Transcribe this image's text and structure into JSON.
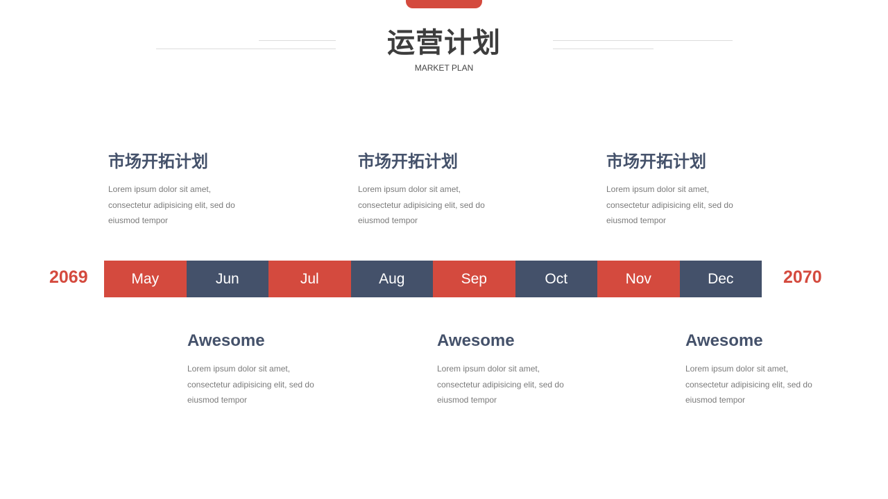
{
  "header": {
    "title": "运营计划",
    "subtitle": "MARKET PLAN"
  },
  "colors": {
    "accent": "#d44a3e",
    "dark": "#44516a"
  },
  "top_blocks": [
    {
      "heading": "市场开拓计划",
      "body": [
        "Lorem ipsum dolor sit amet,",
        "consectetur adipisicing elit, sed do",
        "eiusmod tempor"
      ]
    },
    {
      "heading": "市场开拓计划",
      "body": [
        "Lorem ipsum dolor sit amet,",
        "consectetur adipisicing elit, sed do",
        "eiusmod tempor"
      ]
    },
    {
      "heading": "市场开拓计划",
      "body": [
        "Lorem ipsum dolor sit amet,",
        "consectetur adipisicing elit, sed do",
        "eiusmod tempor"
      ]
    }
  ],
  "timeline": {
    "start_year": "2069",
    "end_year": "2070",
    "months": [
      "May",
      "Jun",
      "Jul",
      "Aug",
      "Sep",
      "Oct",
      "Nov",
      "Dec"
    ]
  },
  "bottom_blocks": [
    {
      "heading": "Awesome",
      "body": [
        "Lorem ipsum dolor sit amet,",
        "consectetur adipisicing elit, sed do",
        "eiusmod tempor"
      ]
    },
    {
      "heading": "Awesome",
      "body": [
        "Lorem ipsum dolor sit amet,",
        "consectetur adipisicing elit, sed do",
        "eiusmod tempor"
      ]
    },
    {
      "heading": "Awesome",
      "body": [
        "Lorem ipsum dolor sit amet,",
        "consectetur adipisicing elit, sed do",
        "eiusmod tempor"
      ]
    }
  ]
}
